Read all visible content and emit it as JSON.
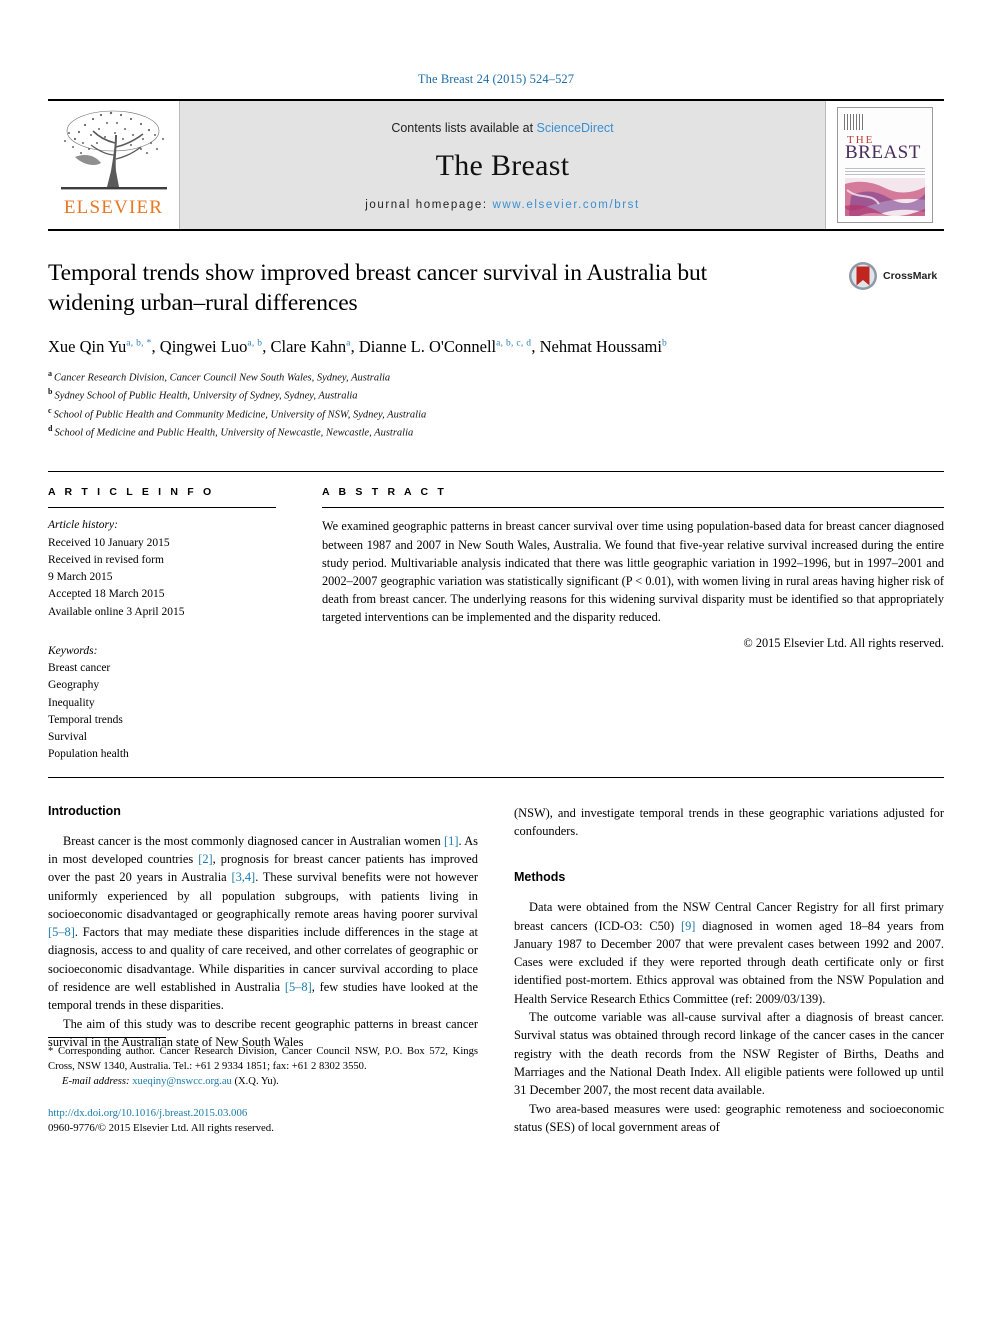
{
  "running_head": "The Breast 24 (2015) 524–527",
  "masthead": {
    "publisher_name": "ELSEVIER",
    "contents_prefix": "Contents lists available at ",
    "contents_link": "ScienceDirect",
    "journal_name": "The Breast",
    "homepage_prefix": "journal homepage: ",
    "homepage_link": "www.elsevier.com/brst",
    "cover": {
      "the": "THE",
      "breast": "BREAST"
    }
  },
  "crossmark": {
    "label": "CrossMark"
  },
  "article": {
    "title": "Temporal trends show improved breast cancer survival in Australia but widening urban–rural differences",
    "authors": [
      {
        "name": "Xue Qin Yu",
        "sup": "a, b, *",
        "sep": ", "
      },
      {
        "name": "Qingwei Luo",
        "sup": "a, b",
        "sep": ", "
      },
      {
        "name": "Clare Kahn",
        "sup": "a",
        "sep": ", "
      },
      {
        "name": "Dianne L. O'Connell",
        "sup": "a, b, c, d",
        "sep": ", "
      },
      {
        "name": "Nehmat Houssami",
        "sup": "b",
        "sep": ""
      }
    ],
    "affiliations": [
      {
        "mark": "a",
        "text": "Cancer Research Division, Cancer Council New South Wales, Sydney, Australia"
      },
      {
        "mark": "b",
        "text": "Sydney School of Public Health, University of Sydney, Sydney, Australia"
      },
      {
        "mark": "c",
        "text": "School of Public Health and Community Medicine, University of NSW, Sydney, Australia"
      },
      {
        "mark": "d",
        "text": "School of Medicine and Public Health, University of Newcastle, Newcastle, Australia"
      }
    ]
  },
  "article_info": {
    "heading": "A R T I C L E   I N F O",
    "history_label": "Article history:",
    "history": [
      "Received 10 January 2015",
      "Received in revised form",
      "9 March 2015",
      "Accepted 18 March 2015",
      "Available online 3 April 2015"
    ],
    "keywords_label": "Keywords:",
    "keywords": [
      "Breast cancer",
      "Geography",
      "Inequality",
      "Temporal trends",
      "Survival",
      "Population health"
    ]
  },
  "abstract": {
    "heading": "A B S T R A C T",
    "text": "We examined geographic patterns in breast cancer survival over time using population-based data for breast cancer diagnosed between 1987 and 2007 in New South Wales, Australia. We found that five-year relative survival increased during the entire study period. Multivariable analysis indicated that there was little geographic variation in 1992–1996, but in 1997–2001 and 2002–2007 geographic variation was statistically significant (P < 0.01), with women living in rural areas having higher risk of death from breast cancer. The underlying reasons for this widening survival disparity must be identified so that appropriately targeted interventions can be implemented and the disparity reduced.",
    "copyright": "© 2015 Elsevier Ltd. All rights reserved."
  },
  "body": {
    "introduction": {
      "heading": "Introduction",
      "p1_a": "Breast cancer is the most commonly diagnosed cancer in Australian women ",
      "p1_r1": "[1]",
      "p1_b": ". As in most developed countries ",
      "p1_r2": "[2]",
      "p1_c": ", prognosis for breast cancer patients has improved over the past 20 years in Australia ",
      "p1_r3": "[3,4]",
      "p1_d": ". These survival benefits were not however uniformly experienced by all population subgroups, with patients living in socioeconomic disadvantaged or geographically remote areas having poorer survival ",
      "p1_r4": "[5–8]",
      "p1_e": ". Factors that may mediate these disparities include differences in the stage at diagnosis, access to and quality of care received, and other correlates of geographic or socioeconomic disadvantage. While disparities in cancer survival according to place of residence are well established in Australia ",
      "p1_r5": "[5–8]",
      "p1_f": ", few studies have looked at the temporal trends in these disparities.",
      "p2_a": "The aim of this study was to describe recent geographic patterns in breast cancer survival in the Australian state of New South Wales (NSW), and investigate temporal trends in these geographic variations adjusted for confounders."
    },
    "methods": {
      "heading": "Methods",
      "p1_a": "Data were obtained from the NSW Central Cancer Registry for all first primary breast cancers (ICD-O3: C50) ",
      "p1_r1": "[9]",
      "p1_b": " diagnosed in women aged 18–84 years from January 1987 to December 2007 that were prevalent cases between 1992 and 2007. Cases were excluded if they were reported through death certificate only or first identified post-mortem. Ethics approval was obtained from the NSW Population and Health Service Research Ethics Committee (ref: 2009/03/139).",
      "p2": "The outcome variable was all-cause survival after a diagnosis of breast cancer. Survival status was obtained through record linkage of the cancer cases in the cancer registry with the death records from the NSW Register of Births, Deaths and Marriages and the National Death Index. All eligible patients were followed up until 31 December 2007, the most recent data available.",
      "p3": "Two area-based measures were used: geographic remoteness and socioeconomic status (SES) of local government areas of"
    }
  },
  "footnote": {
    "corresponding": "* Corresponding author. Cancer Research Division, Cancer Council NSW, P.O. Box 572, Kings Cross, NSW 1340, Australia. Tel.: +61 2 9334 1851; fax: +61 2 8302 3550.",
    "email_label": "E-mail address:",
    "email": "xueqiny@nswcc.org.au",
    "email_suffix": "(X.Q. Yu).",
    "doi": "http://dx.doi.org/10.1016/j.breast.2015.03.006",
    "issn": "0960-9776/© 2015 Elsevier Ltd. All rights reserved."
  },
  "colors": {
    "link": "#1b7ba8",
    "banner_link": "#3a8fd0",
    "elsevier_orange": "#e87722",
    "running_head": "#1b6ca8",
    "banner_bg": "#e3e3e3"
  }
}
